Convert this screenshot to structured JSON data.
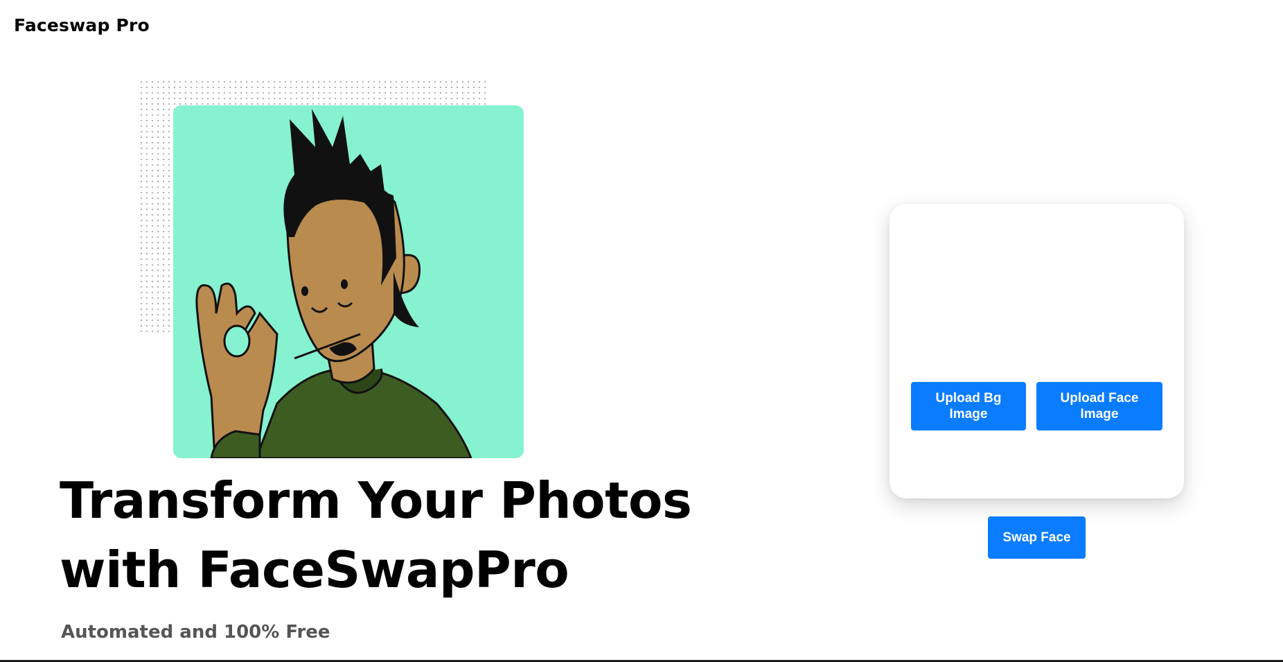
{
  "header": {
    "brand": "Faceswap Pro"
  },
  "hero": {
    "illustration": "cartoon-man-ok-hand-illustration",
    "headline_line1": "Transform Your Photos",
    "headline_line2": "with FaceSwapPro",
    "subtitle": "Automated and 100% Free"
  },
  "upload": {
    "bg_button_label": "Upload Bg Image",
    "face_button_label": "Upload Face Image",
    "swap_button_label": "Swap Face"
  },
  "colors": {
    "accent": "#0a7cff",
    "hero_background": "#86f2cf",
    "hoodie": "#3d5c22",
    "skin": "#b98b4e"
  }
}
